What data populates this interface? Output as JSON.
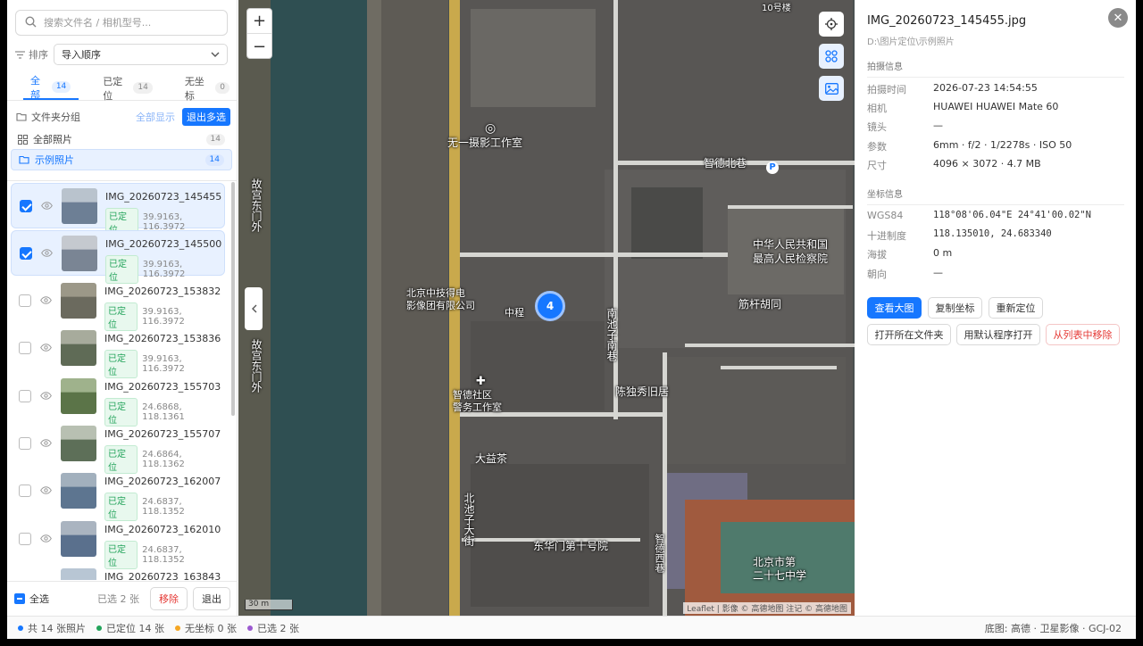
{
  "search": {
    "placeholder": "搜索文件名 / 相机型号..."
  },
  "sort": {
    "label": "排序",
    "value": "导入顺序"
  },
  "tabs": [
    {
      "label": "全部",
      "count": "14"
    },
    {
      "label": "已定位",
      "count": "14"
    },
    {
      "label": "无坐标",
      "count": "0"
    }
  ],
  "folder": {
    "heading": "文件夹分组",
    "show_all": "全部显示",
    "exit_multi": "退出多选"
  },
  "groups": [
    {
      "label": "全部照片",
      "count": "14"
    },
    {
      "label": "示例照片",
      "count": "14"
    }
  ],
  "photos": [
    {
      "name": "IMG_20260723_145455.jpg",
      "status": "已定位",
      "coords": "39.9163, 116.3972",
      "checked": true
    },
    {
      "name": "IMG_20260723_145500.jpg",
      "status": "已定位",
      "coords": "39.9163, 116.3972",
      "checked": true
    },
    {
      "name": "IMG_20260723_153832.jpg",
      "status": "已定位",
      "coords": "39.9163, 116.3972",
      "checked": false
    },
    {
      "name": "IMG_20260723_153836.jpg",
      "status": "已定位",
      "coords": "39.9163, 116.3972",
      "checked": false
    },
    {
      "name": "IMG_20260723_155703.jpg",
      "status": "已定位",
      "coords": "24.6868, 118.1361",
      "checked": false
    },
    {
      "name": "IMG_20260723_155707.jpg",
      "status": "已定位",
      "coords": "24.6864, 118.1362",
      "checked": false
    },
    {
      "name": "IMG_20260723_162007.jpg",
      "status": "已定位",
      "coords": "24.6837, 118.1352",
      "checked": false
    },
    {
      "name": "IMG_20260723_162010.jpg",
      "status": "已定位",
      "coords": "24.6837, 118.1352",
      "checked": false
    },
    {
      "name": "IMG_20260723_163843.jpg",
      "status": "",
      "coords": "",
      "checked": false
    }
  ],
  "footer": {
    "select_all": "全选",
    "selected": "已选 2 张",
    "remove": "移除",
    "exit": "退出"
  },
  "map": {
    "zoom_in": "+",
    "zoom_out": "−",
    "cluster_count": "4",
    "scale": "30 m",
    "attribution": "Leaflet | 影像 © 高德地图 注记 © 高德地图",
    "labels": {
      "top_building": "10号楼",
      "studio": "无一摄影工作室",
      "zhide": "智德北巷",
      "procuratorate": "中华人民共和国\n最高人民检察院",
      "electric": "北京中技得电\n影像团有限公司",
      "zhongguan": "中程",
      "biangan": "筋杆胡同",
      "nanchizi": "南池子南巷",
      "community": "智德社区\n警务工作室",
      "duyishi": "陈独秀旧居",
      "tea": "大益茶",
      "beichizi": "北池子大街",
      "dongyuan": "东华门第十号院",
      "school": "北京市第\n二十七中学",
      "xiangxi": "智德西巷",
      "moat_west": "故宫东门外",
      "moat_west2": "故宫东门外"
    }
  },
  "detail": {
    "title": "IMG_20260723_145455.jpg",
    "path": "D:\\图片定位\\示例照片",
    "shoot_section": "拍摄信息",
    "shoot": [
      {
        "k": "拍摄时间",
        "v": "2026-07-23 14:54:55"
      },
      {
        "k": "相机",
        "v": "HUAWEI HUAWEI Mate 60"
      },
      {
        "k": "镜头",
        "v": "—"
      },
      {
        "k": "参数",
        "v": "6mm · f/2 · 1/2278s · ISO 50"
      },
      {
        "k": "尺寸",
        "v": "4096 × 3072 · 4.7 MB"
      }
    ],
    "coord_section": "坐标信息",
    "coords": [
      {
        "k": "WGS84",
        "v": "118°08'06.04\"E 24°41'00.02\"N"
      },
      {
        "k": "十进制度",
        "v": "118.135010, 24.683340"
      },
      {
        "k": "海拔",
        "v": "0 m"
      },
      {
        "k": "朝向",
        "v": "—"
      }
    ],
    "actions": {
      "view_large": "查看大图",
      "copy_coords": "复制坐标",
      "relocate": "重新定位",
      "open_folder": "打开所在文件夹",
      "open_default": "用默认程序打开",
      "remove_list": "从列表中移除"
    }
  },
  "status": {
    "total": "共 14 张照片",
    "located": "已定位 14 张",
    "no_coords": "无坐标 0 张",
    "selected": "已选 2 张",
    "basemap": "底图: 高德 · 卫星影像 · GCJ-02"
  },
  "colors": {
    "accent": "#1677ff",
    "located": "#22a35a",
    "no_coords": "#f5a623",
    "selected": "#9b59d0",
    "danger": "#e53935"
  }
}
